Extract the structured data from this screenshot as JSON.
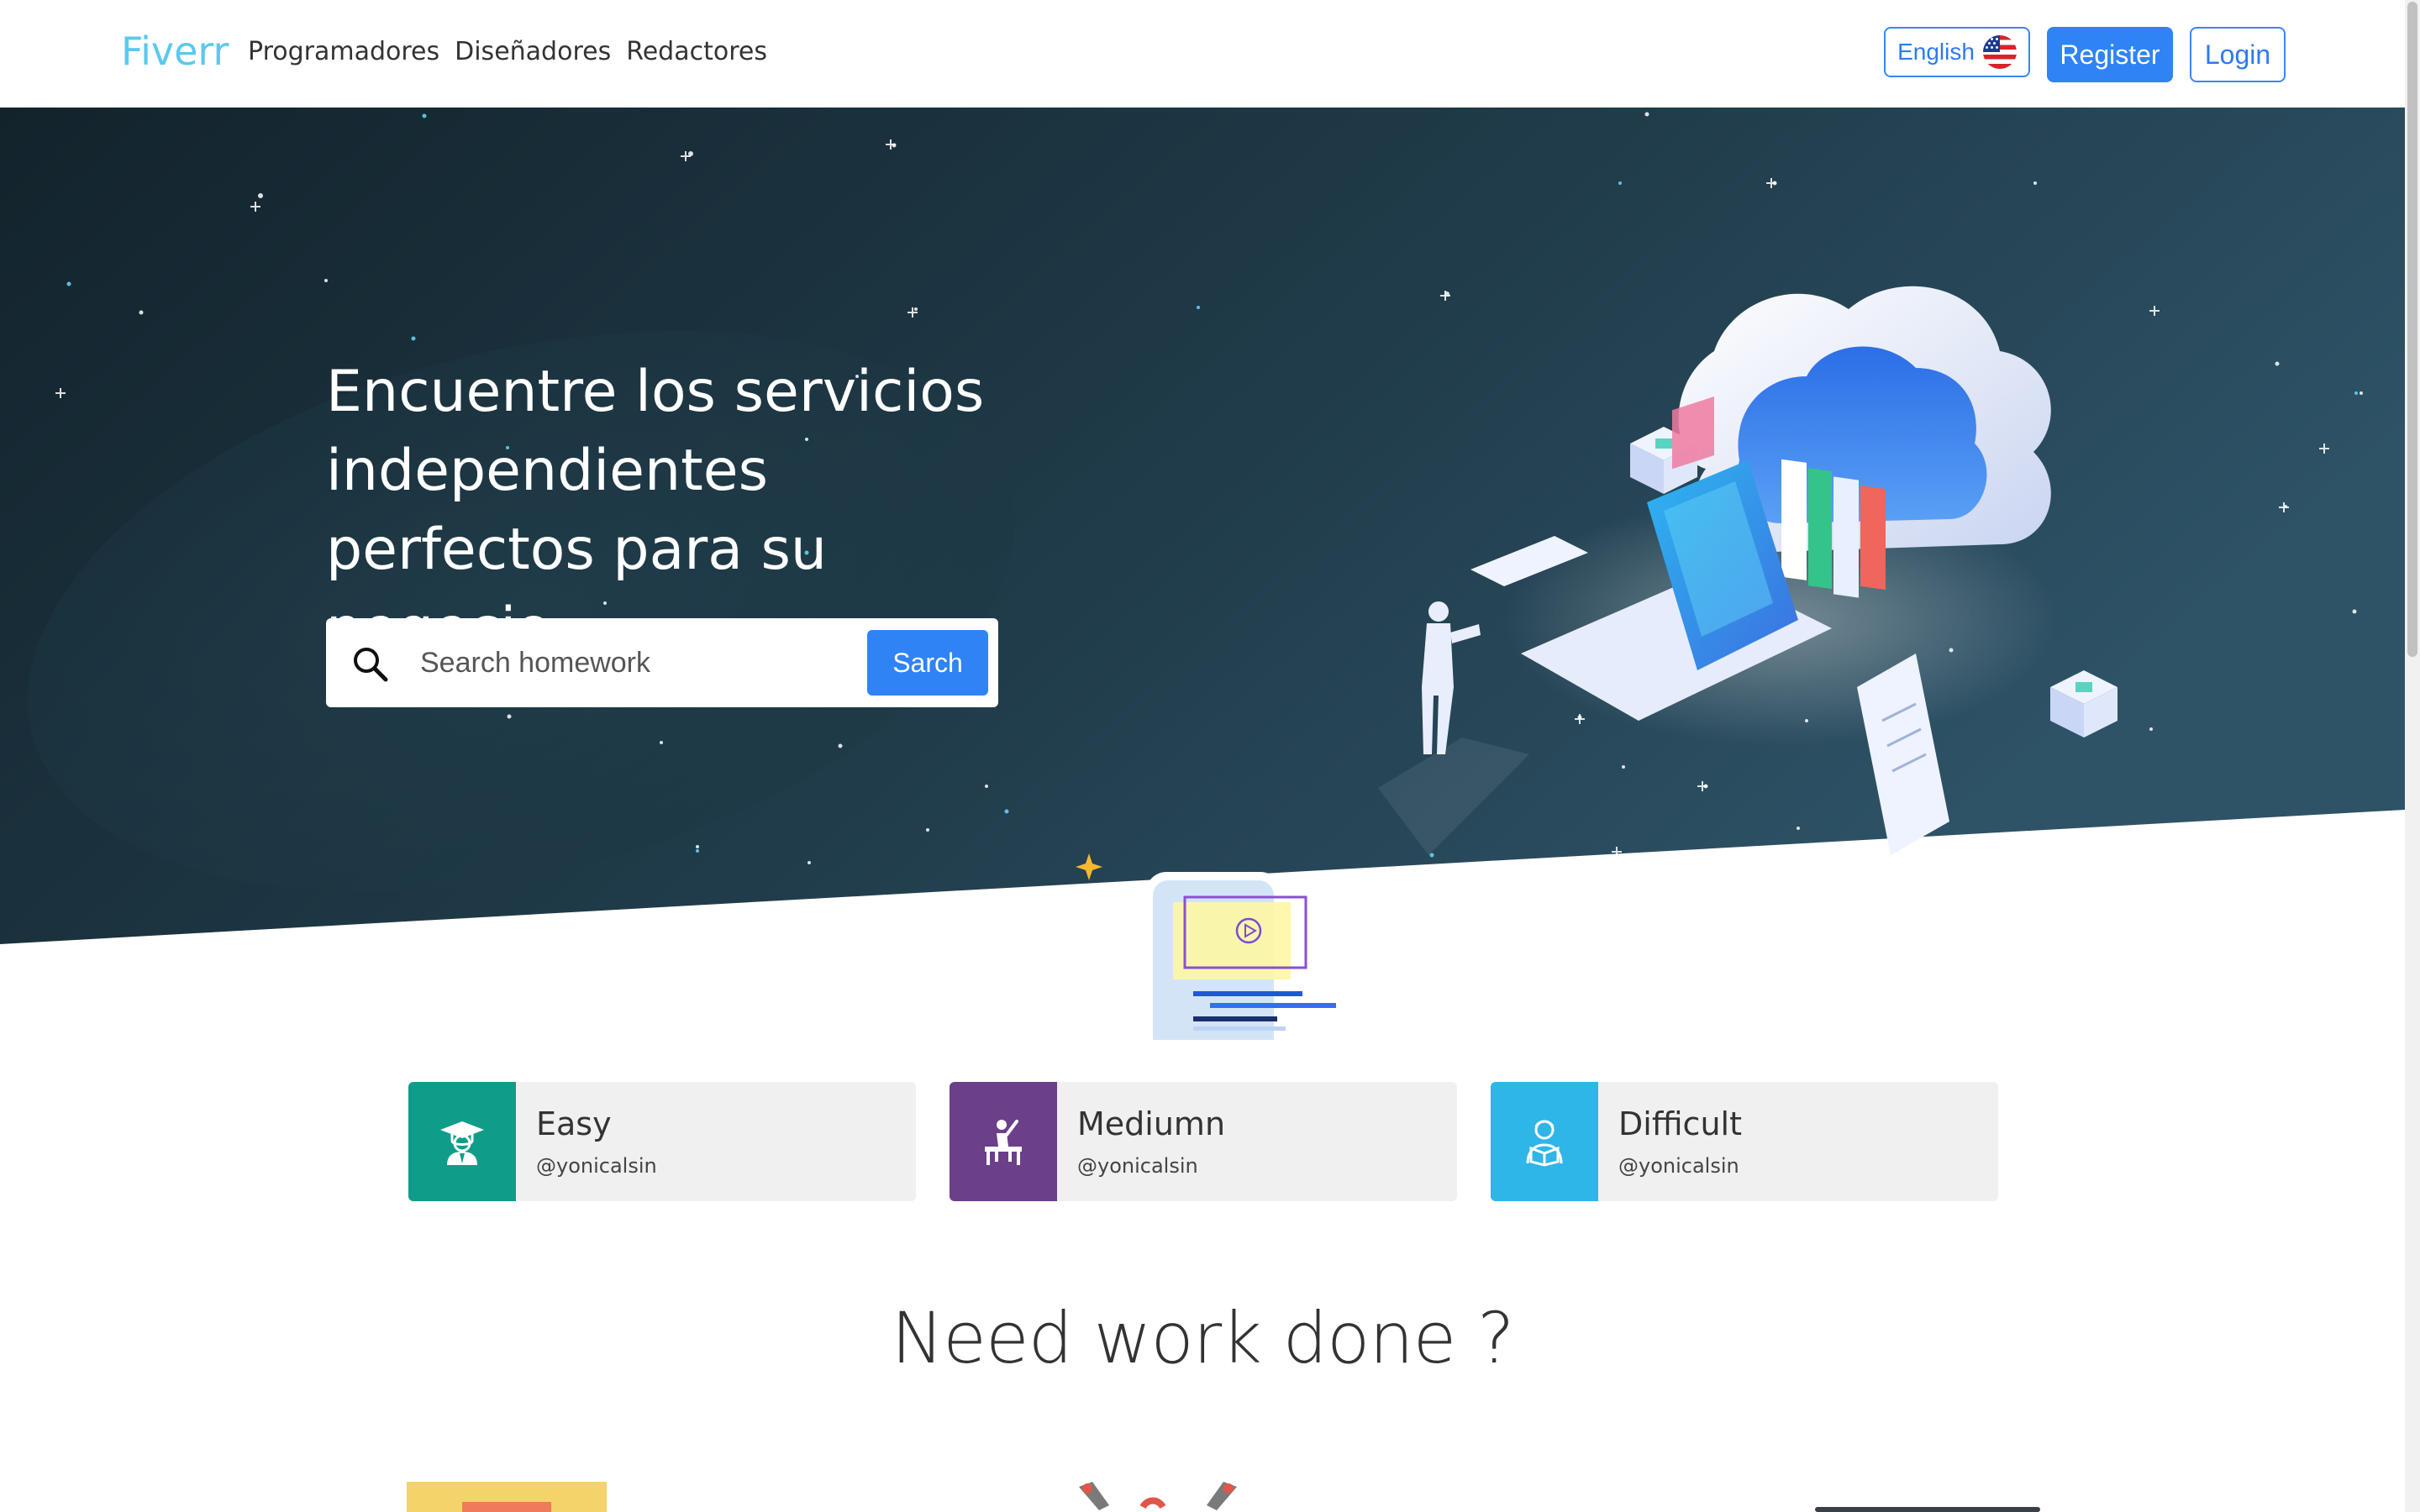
{
  "navbar": {
    "brand": "Fiverr",
    "links": [
      "Programadores",
      "Diseñadores",
      "Redactores"
    ],
    "language_label": "English",
    "language_icon": "us-flag-icon",
    "register_label": "Register",
    "login_label": "Login"
  },
  "hero": {
    "title": "Encuentre los servicios independientes perfectos para su negecio",
    "search": {
      "placeholder": "Search homework",
      "button_label": "Sarch",
      "icon": "search-icon"
    }
  },
  "categories": [
    {
      "title": "Easy",
      "handle": "@yonicalsin",
      "icon": "graduate-icon",
      "color": "#0f9d8a"
    },
    {
      "title": "Mediumn",
      "handle": "@yonicalsin",
      "icon": "student-desk-icon",
      "color": "#6c3f8a"
    },
    {
      "title": "Difficult",
      "handle": "@yonicalsin",
      "icon": "reader-icon",
      "color": "#2eb6e8"
    }
  ],
  "section": {
    "title": "Need work done ?"
  },
  "colors": {
    "brand": "#5bc8ef",
    "primary": "#2f83f5",
    "hero_dark": "#14262f",
    "hero_light": "#2b4b5e"
  }
}
